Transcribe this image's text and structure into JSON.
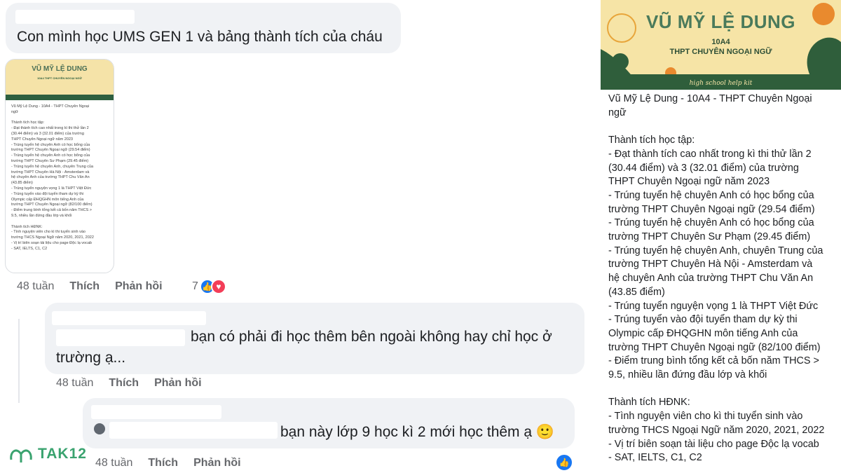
{
  "comment1": {
    "text": "Con mình học UMS GEN 1 và bảng thành tích của cháu",
    "time": "48 tuần",
    "like_label": "Thích",
    "reply_label": "Phản hồi",
    "reaction_count": "7"
  },
  "thumbnail": {
    "banner_name": "VŨ MỸ LỆ DUNG",
    "banner_sub": "10A4 THPT CHUYÊN NGOẠI NGỮ",
    "banner_kit": "high school help kit"
  },
  "comment2": {
    "text": "bạn có phải đi học thêm bên ngoài không hay chỉ học ở trường ạ...",
    "time": "48 tuần",
    "like_label": "Thích",
    "reply_label": "Phản hồi"
  },
  "comment3": {
    "text": "bạn này lớp 9 học kì 2 mới học thêm ạ 🙂",
    "time": "48 tuần",
    "like_label": "Thích",
    "reply_label": "Phản hồi"
  },
  "card": {
    "name": "VŨ MỸ LỆ DUNG",
    "class": "10A4",
    "school": "THPT CHUYÊN NGOẠI NGỮ",
    "kit": "high school help kit",
    "body": "Vũ Mỹ Lệ Dung - 10A4 - THPT Chuyên Ngoại\nngữ\n\nThành tích học tập:\n- Đạt thành tích cao nhất trong kì thi thử lần 2\n(30.44 điểm) và 3 (32.01 điểm) của trường\nTHPT Chuyên Ngoại ngữ năm 2023\n- Trúng tuyển hệ chuyên Anh có học bổng của\ntrường THPT Chuyên Ngoại ngữ (29.54 điểm)\n- Trúng tuyển hệ chuyên Anh có học bổng của\ntrường THPT Chuyên Sư Phạm (29.45 điểm)\n- Trúng tuyển hệ chuyên Anh, chuyên Trung của\ntrường THPT Chuyên Hà Nội - Amsterdam và\nhệ chuyên Anh của trường THPT Chu Văn An\n(43.85 điểm)\n- Trúng tuyển nguyện vọng 1 là THPT Việt Đức\n- Trúng tuyển vào đội tuyển tham dự kỳ thi\nOlympic cấp ĐHQGHN môn tiếng Anh của\ntrường THPT Chuyên Ngoại ngữ (82/100 điểm)\n- Điểm trung bình tổng kết cả bốn năm THCS >\n9.5, nhiều lần đứng đầu lớp và khối\n\nThành tích HĐNK:\n- Tình nguyện viên cho kì thi tuyển sinh vào\ntrường THCS Ngoại Ngữ năm 2020, 2021, 2022\n- Vị trí biên soạn tài liệu cho page Độc lạ vocab\n- SAT, IELTS, C1, C2"
  },
  "watermark": {
    "text": "TAK12"
  },
  "colors": {
    "bubble": "#f0f2f5",
    "meta": "#65676b",
    "like_blue": "#1877f2",
    "heart_red": "#f33e58",
    "brand_green": "#3aa36f"
  }
}
